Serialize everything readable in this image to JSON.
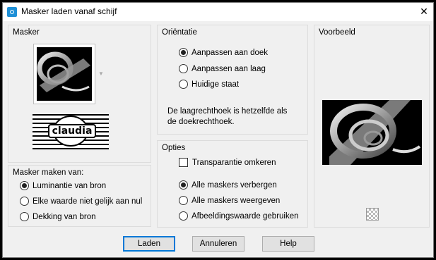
{
  "window": {
    "title": "Masker laden vanaf schijf",
    "close_glyph": "✕"
  },
  "masker": {
    "label": "Masker",
    "logo_text": "claudia"
  },
  "maken_van": {
    "label": "Masker maken van:",
    "options": [
      {
        "label": "Luminantie van bron",
        "checked": true
      },
      {
        "label": "Elke waarde niet gelijk aan nul",
        "checked": false
      },
      {
        "label": "Dekking van bron",
        "checked": false
      }
    ]
  },
  "orientatie": {
    "label": "Oriëntatie",
    "options": [
      {
        "label": "Aanpassen aan doek",
        "checked": true
      },
      {
        "label": "Aanpassen aan laag",
        "checked": false
      },
      {
        "label": "Huidige staat",
        "checked": false
      }
    ],
    "info_line1": "De laagrechthoek is hetzelfde als",
    "info_line2": "de doekrechthoek."
  },
  "opties": {
    "label": "Opties",
    "invert_label": "Transparantie omkeren",
    "invert_checked": false,
    "options": [
      {
        "label": "Alle maskers verbergen",
        "checked": true
      },
      {
        "label": "Alle maskers weergeven",
        "checked": false
      },
      {
        "label": "Afbeeldingswaarde gebruiken",
        "checked": false
      }
    ]
  },
  "voorbeeld": {
    "label": "Voorbeeld"
  },
  "buttons": {
    "load": "Laden",
    "cancel": "Annuleren",
    "help": "Help"
  },
  "icons": {
    "app": "app-icon",
    "close": "close-icon",
    "transparency": "checkerboard-icon"
  }
}
